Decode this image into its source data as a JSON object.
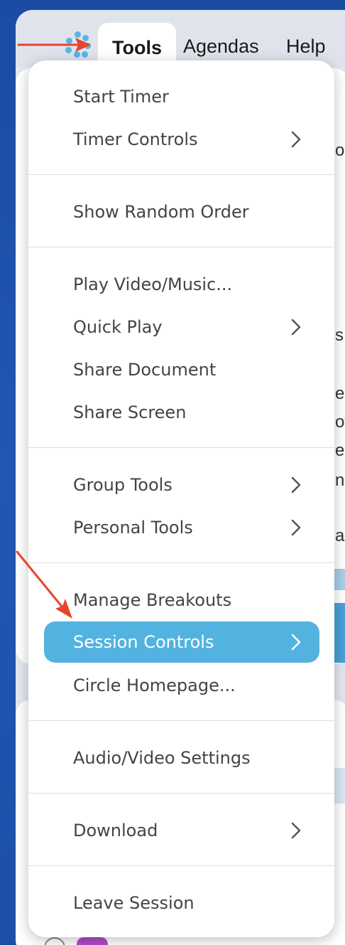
{
  "menubar": {
    "tabs": [
      {
        "label": "Tools"
      },
      {
        "label": "Agendas"
      },
      {
        "label": "Help"
      }
    ]
  },
  "dropdown": {
    "items": [
      {
        "label": "Start Timer",
        "submenu": false
      },
      {
        "label": "Timer Controls",
        "submenu": true
      },
      {
        "label": "Show Random Order",
        "submenu": false
      },
      {
        "label": "Play Video/Music...",
        "submenu": false
      },
      {
        "label": "Quick Play",
        "submenu": true
      },
      {
        "label": "Share Document",
        "submenu": false
      },
      {
        "label": "Share Screen",
        "submenu": false
      },
      {
        "label": "Group Tools",
        "submenu": true
      },
      {
        "label": "Personal Tools",
        "submenu": true
      },
      {
        "label": "Manage Breakouts",
        "submenu": false
      },
      {
        "label": "Session Controls",
        "submenu": true,
        "highlighted": true
      },
      {
        "label": "Circle Homepage...",
        "submenu": false
      },
      {
        "label": "Audio/Video Settings",
        "submenu": false
      },
      {
        "label": "Download",
        "submenu": true
      },
      {
        "label": "Leave Session",
        "submenu": false
      }
    ]
  },
  "colors": {
    "highlight": "#53b3e0",
    "annotation_arrow": "#e8452e",
    "background": "#1b4ba3"
  },
  "background_fragments": {
    "t1": "o",
    "t2": "s",
    "t3": "e",
    "t4": "ot",
    "t5": "e",
    "t6": "nd",
    "t7": "ad"
  }
}
